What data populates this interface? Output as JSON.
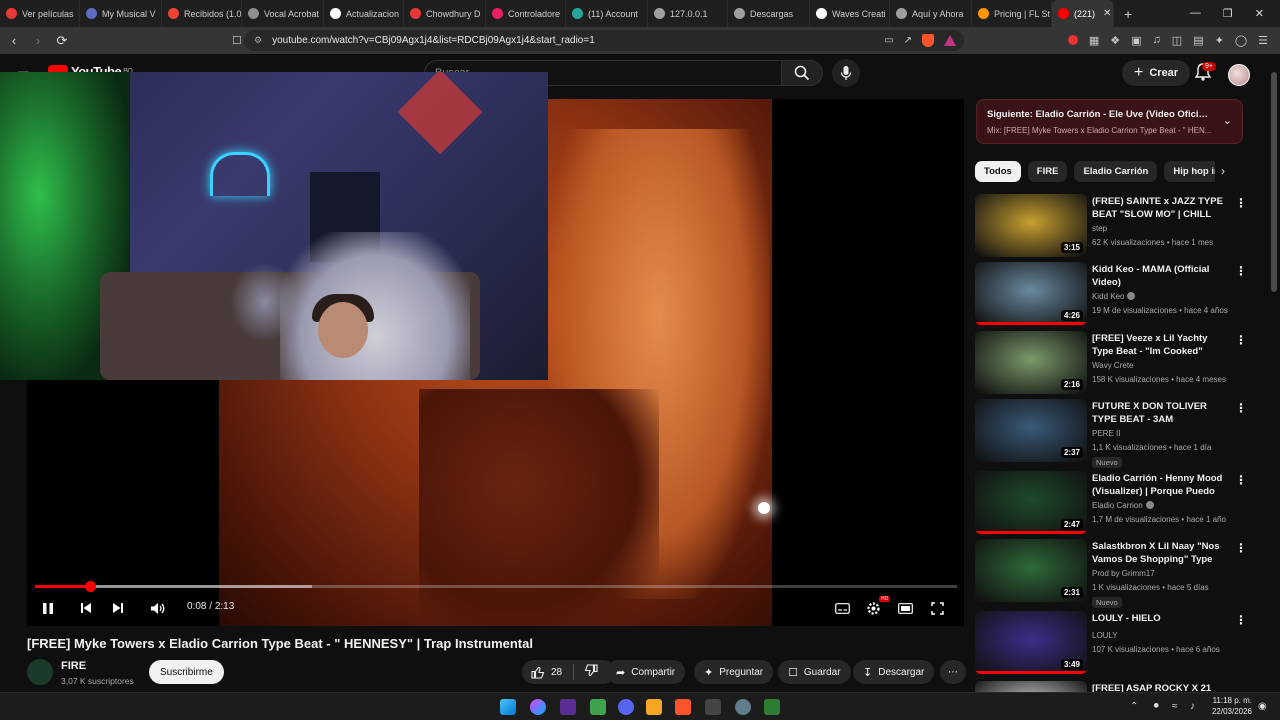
{
  "browser": {
    "tabs": [
      {
        "label": "Ver películas",
        "color": "#e53935"
      },
      {
        "label": "My Musical V",
        "color": "#5c6bc0"
      },
      {
        "label": "Recibidos (1.0",
        "color": "#ea4335"
      },
      {
        "label": "Vocal Acrobat",
        "color": "#8e8e8e"
      },
      {
        "label": "Actualizacion",
        "color": "#ffffff"
      },
      {
        "label": "Chowdhury D",
        "color": "#e53935"
      },
      {
        "label": "Controladore",
        "color": "#e91e63"
      },
      {
        "label": "(11) Account",
        "color": "#26a69a"
      },
      {
        "label": "127.0.0.1",
        "color": "#9e9e9e"
      },
      {
        "label": "Descargas",
        "color": "#9e9e9e"
      },
      {
        "label": "Waves Creati",
        "color": "#ffffff"
      },
      {
        "label": "Aquí y Ahora",
        "color": "#9e9e9e"
      },
      {
        "label": "Pricing | FL St",
        "color": "#ff9800"
      },
      {
        "label": "(221)",
        "color": "#ff0000"
      }
    ],
    "address": "youtube.com/watch?v=CBj09Agx1j4&list=RDCBj09Agx1j4&start_radio=1"
  },
  "youtube": {
    "logo_text": "YouTube",
    "region": "BO",
    "search_placeholder": "Buscar",
    "create_label": "Crear",
    "notif_count": "9+"
  },
  "player": {
    "current_time": "0:08",
    "duration": "2:13",
    "progress": 0.06,
    "buffered": 0.3
  },
  "video": {
    "title": "[FREE] Myke Towers x Eladio Carrion Type Beat - \" HENNESY\" | Trap Instrumental",
    "channel": "FIRE",
    "subscribers": "3,07 K suscriptores",
    "subscribe_label": "Suscribirme",
    "likes": "28",
    "share_label": "Compartir",
    "ask_label": "Preguntar",
    "save_label": "Guardar",
    "download_label": "Descargar"
  },
  "next_up": {
    "title": "Siguiente: Eladio Carrión - Ele Uve (Video Oficial) | S...",
    "subtitle": "Mix: [FREE] Myke Towers x Eladio Carrion Type Beat - \" HEN..."
  },
  "chips": [
    "Todos",
    "FIRE",
    "Eladio Carrión",
    "Hip hop instru"
  ],
  "recommendations": [
    {
      "title": "(FREE) SAINTE x JAZZ TYPE BEAT \"SLOW MO\" | CHILL RAP ...",
      "channel": "step",
      "meta": "62 K visualizaciones • hace 1 mes",
      "duration": "3:15",
      "verified": false,
      "badge": "",
      "watched": 0,
      "thumb": "#c8a030"
    },
    {
      "title": "Kidd Keo - MAMA (Official Video)",
      "channel": "Kidd Keo",
      "meta": "19 M de visualizaciones • hace 4 años",
      "duration": "4:26",
      "verified": true,
      "badge": "",
      "watched": 1,
      "thumb": "#6a8aa0"
    },
    {
      "title": "[FREE] Veeze x Lil Yachty Type Beat - \"Im Cooked\"",
      "channel": "Wavy Crete",
      "meta": "158 K visualizaciones • hace 4 meses",
      "duration": "2:16",
      "verified": false,
      "badge": "",
      "watched": 0,
      "thumb": "#7a9a6a"
    },
    {
      "title": "FUTURE X DON TOLIVER TYPE BEAT - 3AM",
      "channel": "PERE II",
      "meta": "1,1 K visualizaciones • hace 1 día",
      "duration": "2:37",
      "verified": false,
      "badge": "Nuevo",
      "watched": 0,
      "thumb": "#3a5a7a"
    },
    {
      "title": "Eladio Carrión - Henny Mood (Visualizer) | Porque Puedo",
      "channel": "Eladio Carrion",
      "meta": "1,7 M de visualizaciones • hace 1 año",
      "duration": "2:47",
      "verified": true,
      "badge": "",
      "watched": 1,
      "thumb": "#1f4a2a"
    },
    {
      "title": "Salastkbron X Lil Naay \"Nos Vamos De Shopping\" Type Bea...",
      "channel": "Prod by Grimm17",
      "meta": "1 K visualizaciones • hace 5 días",
      "duration": "2:31",
      "verified": false,
      "badge": "Nuevo",
      "watched": 0,
      "thumb": "#2f6a3a"
    },
    {
      "title": "LOULY - HIELO",
      "channel": "LOULY",
      "meta": "107 K visualizaciones • hace 6 años",
      "duration": "3:49",
      "verified": false,
      "badge": "",
      "watched": 1,
      "thumb": "#3a2f8a"
    },
    {
      "title": "[FREE] ASAP ROCKY X 21",
      "channel": "",
      "meta": "",
      "duration": "",
      "verified": false,
      "badge": "",
      "watched": 0,
      "thumb": "#ddd"
    }
  ],
  "system": {
    "time": "11:18 p. m.",
    "date": "22/03/2026"
  }
}
